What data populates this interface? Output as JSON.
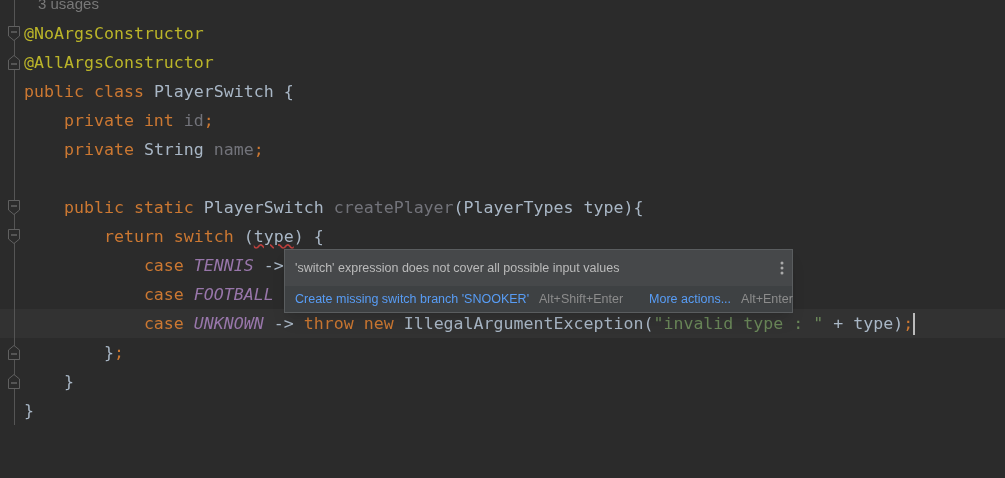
{
  "editor": {
    "lines": [
      {
        "inlay": "3 usages",
        "fold_start": false,
        "fold_end": false
      },
      {
        "tokens": [
          {
            "kind": "annotation",
            "text": "@NoArgsConstructor"
          }
        ],
        "fold_start": true,
        "fold_end": false
      },
      {
        "tokens": [
          {
            "kind": "annotation",
            "text": "@AllArgsConstructor"
          }
        ],
        "fold_start": false,
        "fold_end": true
      },
      {
        "tokens": [
          {
            "kind": "keyword",
            "text": "public class "
          },
          {
            "kind": "plain",
            "text": "PlayerSwitch {"
          }
        ],
        "fold_start": false,
        "fold_end": false
      },
      {
        "tokens": [
          {
            "kind": "keyword",
            "text": "    private int "
          },
          {
            "kind": "unused",
            "text": "id"
          },
          {
            "kind": "keyword",
            "text": ";"
          }
        ],
        "fold_start": false,
        "fold_end": false
      },
      {
        "tokens": [
          {
            "kind": "keyword",
            "text": "    private "
          },
          {
            "kind": "plain",
            "text": "String "
          },
          {
            "kind": "unused",
            "text": "name"
          },
          {
            "kind": "keyword",
            "text": ";"
          }
        ],
        "fold_start": false,
        "fold_end": false
      },
      {
        "fold_start": false,
        "fold_end": false
      },
      {
        "tokens": [
          {
            "kind": "keyword",
            "text": "    public static "
          },
          {
            "kind": "plain",
            "text": "PlayerSwitch "
          },
          {
            "kind": "unused",
            "text": "createPlayer"
          },
          {
            "kind": "plain",
            "text": "(PlayerTypes type){"
          }
        ],
        "fold_start": true,
        "fold_end": false
      },
      {
        "tokens": [
          {
            "kind": "keyword",
            "text": "        return switch "
          },
          {
            "kind": "plain",
            "text": "("
          },
          {
            "kind": "plain",
            "text": "type",
            "error": true
          },
          {
            "kind": "plain",
            "text": ") {"
          }
        ],
        "fold_start": true,
        "fold_end": false
      },
      {
        "tokens": [
          {
            "kind": "keyword",
            "text": "            case "
          },
          {
            "kind": "enum",
            "text": "TENNIS"
          },
          {
            "kind": "plain",
            "text": " ->"
          }
        ],
        "fold_start": false,
        "fold_end": false
      },
      {
        "tokens": [
          {
            "kind": "keyword",
            "text": "            case "
          },
          {
            "kind": "enum",
            "text": "FOOTBALL"
          }
        ],
        "fold_start": false,
        "fold_end": false
      },
      {
        "tokens": [
          {
            "kind": "keyword",
            "text": "            case "
          },
          {
            "kind": "enum",
            "text": "UNKNOWN"
          },
          {
            "kind": "plain",
            "text": " -> "
          },
          {
            "kind": "keyword",
            "text": "throw new "
          },
          {
            "kind": "plain",
            "text": "IllegalArgumentException("
          },
          {
            "kind": "string",
            "text": "\"invalid type : \""
          },
          {
            "kind": "plain",
            "text": " + type)"
          },
          {
            "kind": "keyword",
            "text": ";"
          }
        ],
        "fold_start": false,
        "fold_end": false,
        "caret": true
      },
      {
        "tokens": [
          {
            "kind": "plain",
            "text": "        }"
          },
          {
            "kind": "keyword",
            "text": ";"
          }
        ],
        "fold_start": false,
        "fold_end": true
      },
      {
        "tokens": [
          {
            "kind": "plain",
            "text": "    }"
          }
        ],
        "fold_start": false,
        "fold_end": true
      },
      {
        "tokens": [
          {
            "kind": "plain",
            "text": "}"
          }
        ],
        "fold_start": false,
        "fold_end": false
      }
    ]
  },
  "popup": {
    "message": "'switch' expression does not cover all possible input values",
    "actions": [
      {
        "kind": "link",
        "text": "Create missing switch branch 'SNOOKER'"
      },
      {
        "kind": "shortcut",
        "text": "Alt+Shift+Enter"
      },
      {
        "kind": "link",
        "text": "More actions..."
      },
      {
        "kind": "shortcut",
        "text": "Alt+Enter"
      }
    ]
  }
}
